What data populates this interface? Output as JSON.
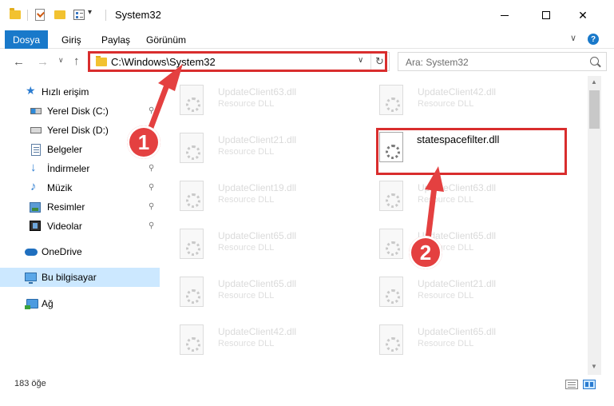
{
  "window": {
    "title": "System32",
    "quick_access_dropdown": "▾",
    "minimize": "—",
    "maximize": "",
    "close": "✕"
  },
  "ribbon": {
    "tabs": [
      "Dosya",
      "Giriş",
      "Paylaş",
      "Görünüm"
    ],
    "expand": "∨",
    "help": "?"
  },
  "nav": {
    "back": "←",
    "forward": "→",
    "recent": "∨",
    "up": "↑",
    "address": "C:\\Windows\\System32",
    "address_dropdown": "∨",
    "refresh": "↻",
    "search_placeholder": "Ara: System32"
  },
  "sidebar": {
    "items": [
      {
        "label": "Hızlı erişim",
        "icon": "star-icon",
        "pinned": false
      },
      {
        "label": "Yerel Disk (C:)",
        "icon": "drive-c-icon",
        "pinned": true
      },
      {
        "label": "Yerel Disk (D:)",
        "icon": "drive-icon",
        "pinned": true
      },
      {
        "label": "Belgeler",
        "icon": "documents-icon",
        "pinned": true
      },
      {
        "label": "İndirmeler",
        "icon": "downloads-icon",
        "pinned": true
      },
      {
        "label": "Müzik",
        "icon": "music-icon",
        "pinned": true
      },
      {
        "label": "Resimler",
        "icon": "pictures-icon",
        "pinned": true
      },
      {
        "label": "Videolar",
        "icon": "videos-icon",
        "pinned": true
      },
      {
        "label": "OneDrive",
        "icon": "onedrive-icon",
        "pinned": false
      },
      {
        "label": "Bu bilgisayar",
        "icon": "this-pc-icon",
        "pinned": false,
        "selected": true
      },
      {
        "label": "Ağ",
        "icon": "network-icon",
        "pinned": false
      }
    ],
    "pin_glyph": "📌"
  },
  "files": {
    "left": [
      {
        "name": "UpdateClient63.dll",
        "type": "Resource DLL"
      },
      {
        "name": "UpdateClient21.dll",
        "type": "Resource DLL"
      },
      {
        "name": "UpdateClient19.dll",
        "type": "Resource DLL"
      },
      {
        "name": "UpdateClient65.dll",
        "type": "Resource DLL"
      },
      {
        "name": "UpdateClient65.dll",
        "type": "Resource DLL"
      },
      {
        "name": "UpdateClient42.dll",
        "type": "Resource DLL"
      }
    ],
    "right": [
      {
        "name": "UpdateClient42.dll",
        "type": "Resource DLL"
      },
      {
        "name": "statespacefilter.dll",
        "type": "",
        "highlighted": true
      },
      {
        "name": "UpdateClient63.dll",
        "type": "Resource DLL"
      },
      {
        "name": "UpdateClient65.dll",
        "type": "Resource DLL"
      },
      {
        "name": "UpdateClient21.dll",
        "type": "Resource DLL"
      },
      {
        "name": "UpdateClient65.dll",
        "type": "Resource DLL"
      }
    ]
  },
  "scrollbar": {
    "up": "▲",
    "down": "▼"
  },
  "status": {
    "count": "183 öğe"
  },
  "annotations": {
    "badge1": "1",
    "badge2": "2",
    "arrow_color": "#e44040",
    "highlight_color": "#d92d2d"
  },
  "colors": {
    "accent": "#1979ca",
    "selection": "#cce8ff"
  }
}
